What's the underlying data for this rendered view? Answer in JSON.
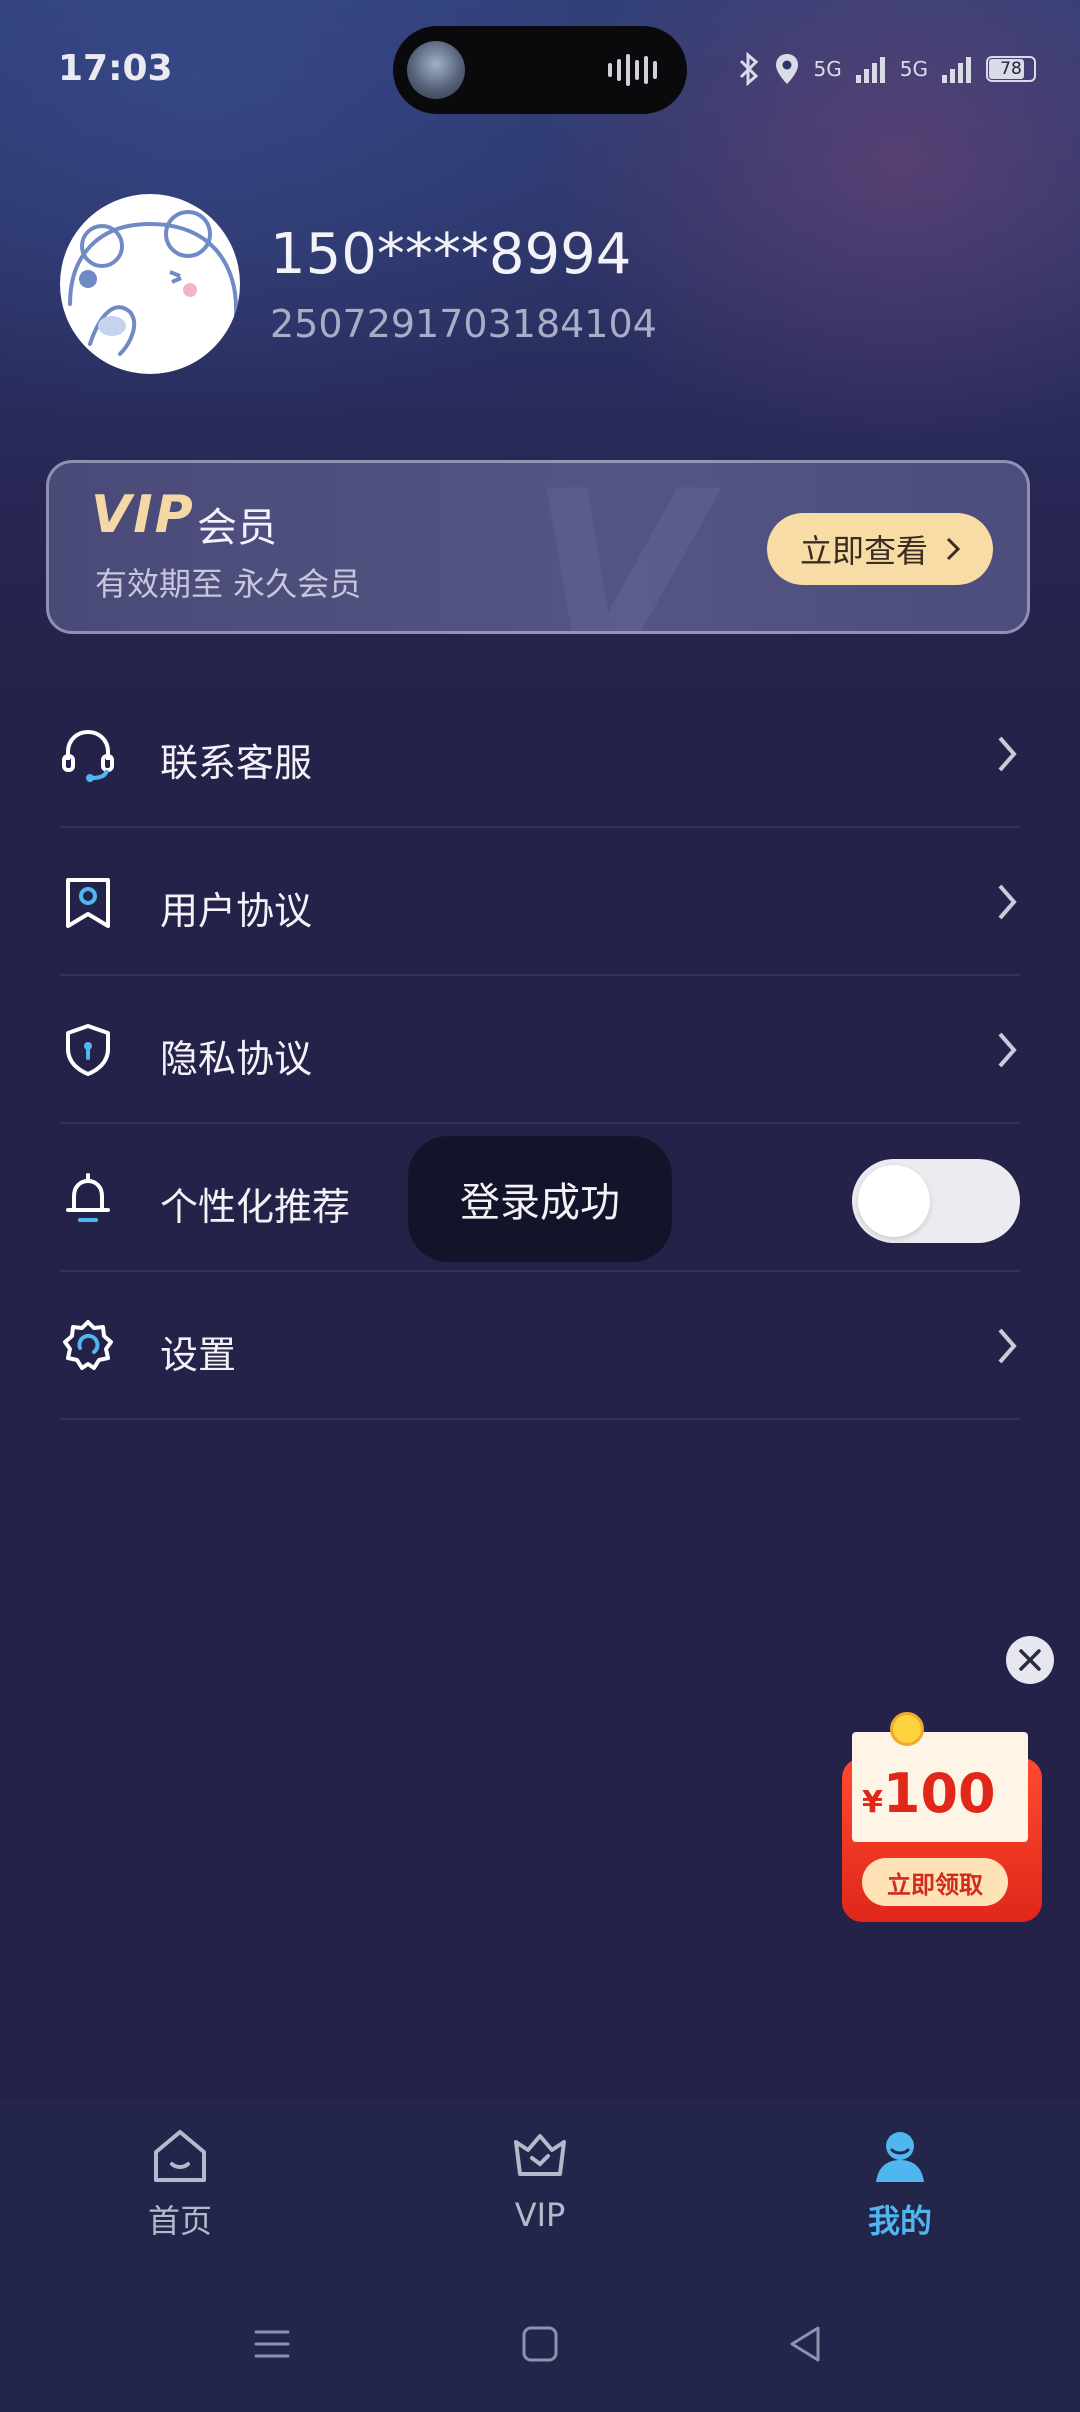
{
  "status_bar": {
    "time": "17:03",
    "network_1": "5G",
    "network_2": "5G",
    "battery": "78"
  },
  "profile": {
    "phone": "150****8994",
    "user_id": "2507291703184104"
  },
  "vip_card": {
    "logo": "VIP",
    "title": "会员",
    "validity": "有效期至 永久会员",
    "button_label": "立即查看"
  },
  "menu": {
    "items": [
      {
        "label": "联系客服"
      },
      {
        "label": "用户协议"
      },
      {
        "label": "隐私协议"
      },
      {
        "label": "个性化推荐"
      },
      {
        "label": "设置"
      }
    ]
  },
  "toggle": {
    "personalized_recommend_on": false
  },
  "toast": {
    "text": "登录成功"
  },
  "red_packet": {
    "currency": "¥",
    "amount": "100",
    "button_label": "立即领取"
  },
  "tabbar": {
    "tabs": [
      {
        "label": "首页"
      },
      {
        "label": "VIP"
      },
      {
        "label": "我的"
      }
    ],
    "active": "我的"
  },
  "colors": {
    "background": "#25224a",
    "accent": "#4fb6f0",
    "vip_gold": "#f8dca6",
    "packet_red": "#e0271a"
  }
}
